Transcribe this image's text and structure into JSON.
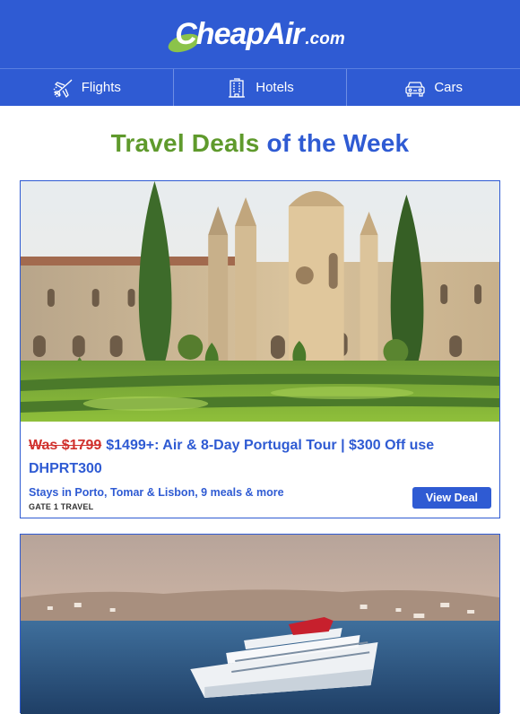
{
  "header": {
    "logo_text": "CheapAir",
    "logo_suffix": ".com"
  },
  "nav": [
    {
      "label": "Flights",
      "icon": "airplane-icon"
    },
    {
      "label": "Hotels",
      "icon": "hotel-building-icon"
    },
    {
      "label": "Cars",
      "icon": "car-icon"
    }
  ],
  "page": {
    "title_part1": "Travel Deals",
    "title_part2": "of the Week"
  },
  "deals": [
    {
      "was_price": "Was $1799",
      "headline": "$1499+: Air & 8-Day Portugal Tour | $300 Off use DHPRT300",
      "subtitle": "Stays in Porto, Tomar & Lisbon, 9 meals & more",
      "vendor": "GATE 1 TRAVEL",
      "button_label": "View Deal",
      "image": "monastery-photo"
    },
    {
      "image": "cruise-ship-photo"
    }
  ],
  "colors": {
    "brand_blue": "#2f5bd3",
    "accent_green": "#5f9a2c",
    "was_red": "#d0312d"
  }
}
